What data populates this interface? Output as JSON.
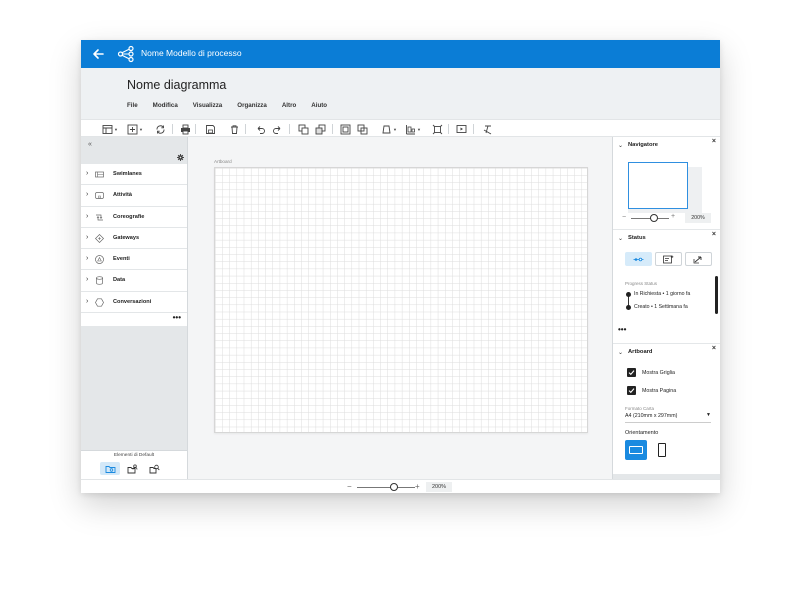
{
  "appbar": {
    "title": "Nome Modello di processo"
  },
  "header": {
    "diagram_title": "Nome diagramma"
  },
  "menubar": {
    "items": [
      "File",
      "Modifica",
      "Visualizza",
      "Organizza",
      "Altro",
      "Aiuto"
    ]
  },
  "toolbar": {
    "icons": [
      "table-icon",
      "insert-icon",
      "refresh-icon",
      "print-icon",
      "save-icon",
      "delete-icon",
      "undo-icon",
      "redo-icon",
      "bring-front-icon",
      "send-back-icon",
      "group-icon",
      "ungroup-icon",
      "shape-style-icon",
      "align-icon",
      "fit-icon",
      "present-icon",
      "clear-format-icon"
    ]
  },
  "left_panel": {
    "collapse_glyph": "«",
    "categories": [
      {
        "label": "Swimlanes",
        "icon": "swimlane-icon"
      },
      {
        "label": "Attività",
        "icon": "activity-icon"
      },
      {
        "label": "Coreografie",
        "icon": "choreography-icon"
      },
      {
        "label": "Gateways",
        "icon": "gateway-icon"
      },
      {
        "label": "Eventi",
        "icon": "event-icon"
      },
      {
        "label": "Data",
        "icon": "data-icon"
      },
      {
        "label": "Conversazioni",
        "icon": "conversation-icon"
      }
    ],
    "more": "•••",
    "footer_label": "Elementi di Default"
  },
  "canvas": {
    "artboard_label": "Artboard"
  },
  "bottombar": {
    "zoom_minus": "−",
    "zoom_plus": "+",
    "zoom_value": "200%"
  },
  "right_panel": {
    "navigator": {
      "title": "Navigatore",
      "close": "×",
      "zoom_value": "200%",
      "zoom_minus": "−",
      "zoom_plus": "+"
    },
    "status": {
      "title": "Status",
      "close": "×",
      "progress_label": "Progress Status",
      "entries": [
        "In Richiesta • 1 giorno fa",
        "Creato • 1 Settimana fa"
      ],
      "more": "•••"
    },
    "artboard": {
      "title": "Artboard",
      "close": "×",
      "show_grid": "Mostra Griglia",
      "show_page": "Mostra Pagina",
      "paper_format_label": "Formato Carta",
      "paper_format_value": "A4 (210mm x 297mm)",
      "orientation_label": "Orientamento"
    }
  },
  "colors": {
    "accent": "#0b7dd6",
    "panel_bg": "#e4e7e9",
    "header_bg": "#eef1f3"
  }
}
